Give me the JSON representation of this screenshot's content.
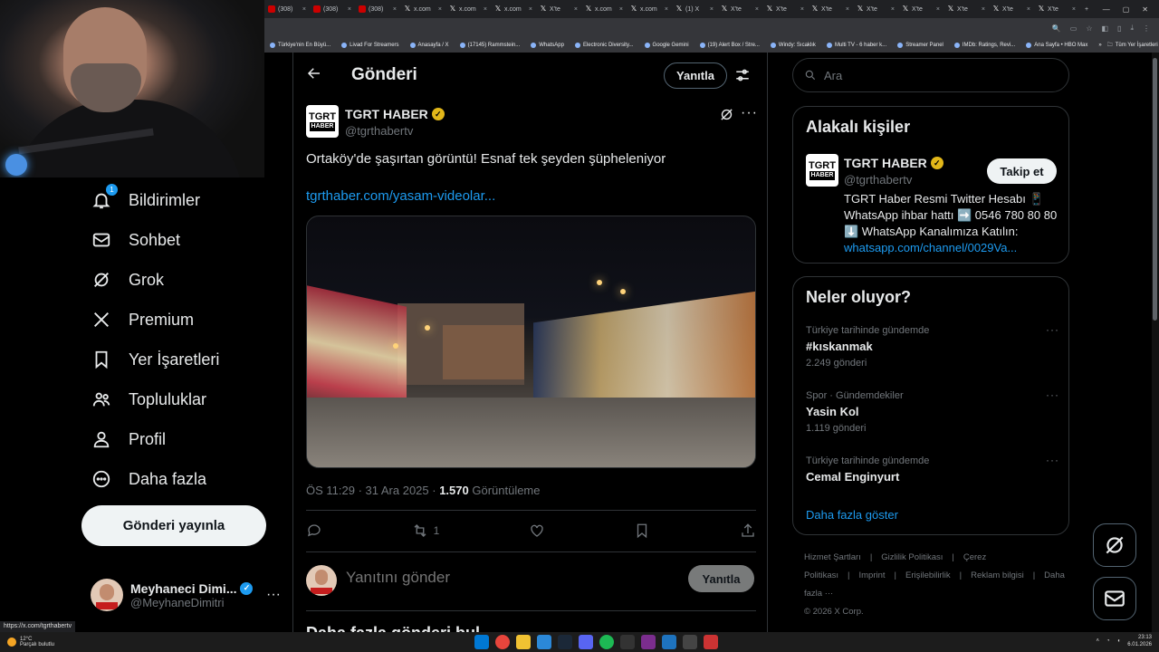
{
  "browser": {
    "tabs": [
      {
        "label": "(308)",
        "icon": "youtube-icon"
      },
      {
        "label": "(308)",
        "icon": "youtube-icon"
      },
      {
        "label": "(308)",
        "icon": "youtube-icon"
      },
      {
        "label": "x.com",
        "icon": "x-icon"
      },
      {
        "label": "x.com",
        "icon": "x-icon"
      },
      {
        "label": "x.com",
        "icon": "x-icon"
      },
      {
        "label": "X'te",
        "icon": "x-icon"
      },
      {
        "label": "x.com",
        "icon": "x-icon"
      },
      {
        "label": "x.com",
        "icon": "x-icon"
      },
      {
        "label": "(1) X",
        "icon": "x-icon"
      },
      {
        "label": "X'te",
        "icon": "x-icon"
      },
      {
        "label": "X'te",
        "icon": "x-icon"
      },
      {
        "label": "X'te",
        "icon": "x-icon"
      },
      {
        "label": "X'te",
        "icon": "x-icon"
      },
      {
        "label": "X'te",
        "icon": "x-icon"
      },
      {
        "label": "X'te",
        "icon": "x-icon"
      },
      {
        "label": "X'te",
        "icon": "x-icon"
      },
      {
        "label": "X'te",
        "icon": "x-icon"
      }
    ],
    "bookmarks": [
      "Türkiye'nin En Büyü...",
      "Livad For Streamers",
      "Anasayfa / X",
      "(17145) Rammstein...",
      "WhatsApp",
      "Electronic Diversity...",
      "Google Gemini",
      "(19) Alert Box / Stre...",
      "Windy: Sıcaklık",
      "Multi TV - 6 haber k...",
      "Streamer Panel",
      "IMDb: Ratings, Revi...",
      "Ana Sayfa • HBO Max"
    ],
    "bookmarks_more": "»",
    "all_bookmarks": "Tüm Yer İşaretleri",
    "status_url": "https://x.com/tgrthabertv"
  },
  "nav": {
    "items": [
      {
        "label": "Bildirimler",
        "icon": "bell-icon",
        "badge": "1"
      },
      {
        "label": "Sohbet",
        "icon": "mail-icon"
      },
      {
        "label": "Grok",
        "icon": "grok-icon"
      },
      {
        "label": "Premium",
        "icon": "x-logo-icon"
      },
      {
        "label": "Yer İşaretleri",
        "icon": "bookmark-icon"
      },
      {
        "label": "Topluluklar",
        "icon": "people-icon"
      },
      {
        "label": "Profil",
        "icon": "person-icon"
      },
      {
        "label": "Daha fazla",
        "icon": "more-circle-icon"
      }
    ],
    "post_button": "Gönderi yayınla",
    "profile": {
      "name": "Meyhaneci Dimi...",
      "handle": "@MeyhaneDimitri",
      "more": "···"
    }
  },
  "header": {
    "title": "Gönderi",
    "reply_button": "Yanıtla"
  },
  "tweet": {
    "author_name": "TGRT HABER",
    "author_handle": "@tgrthabertv",
    "avatar_text_1": "TGRT",
    "avatar_text_2": "HABER",
    "text": "Ortaköy'de şaşırtan görüntü! Esnaf tek şeyden şüpheleniyor",
    "link": "tgrthaber.com/yasam-videolar...",
    "time": "ÖS 11:29 · 31 Ara 2025 · ",
    "views_count": "1.570",
    "views_label": " Görüntüleme",
    "retweets": "1",
    "more": "···"
  },
  "reply": {
    "placeholder": "Yanıtını gönder",
    "button": "Yanıtla"
  },
  "next_heading": "Daha fazla gönderi bul",
  "search": {
    "placeholder": "Ara"
  },
  "related": {
    "title": "Alakalı kişiler",
    "name": "TGRT HABER",
    "handle": "@tgrthabertv",
    "follow_button": "Takip et",
    "bio": "TGRT Haber Resmi Twitter Hesabı 📱 WhatsApp ihbar hattı ➡️ 0546 780 80 80 ⬇️ WhatsApp Kanalımıza Katılın:",
    "bio_link": "whatsapp.com/channel/0029Va..."
  },
  "trends": {
    "title": "Neler oluyor?",
    "items": [
      {
        "category": "Türkiye tarihinde gündemde",
        "topic": "#kıskanmak",
        "count": "2.249 gönderi"
      },
      {
        "category": "Spor · Gündemdekiler",
        "topic": "Yasin Kol",
        "count": "1.119 gönderi"
      },
      {
        "category": "Türkiye tarihinde gündemde",
        "topic": "Cemal Enginyurt",
        "count": ""
      }
    ],
    "show_more": "Daha fazla göster"
  },
  "footer": {
    "links": [
      "Hizmet Şartları",
      "|",
      "Gizlilik Politikası",
      "|",
      "Çerez Politikası",
      "|",
      "Imprint",
      "|",
      "Erişilebilirlik",
      "|",
      "Reklam bilgisi",
      "|",
      "Daha fazla ···"
    ],
    "copyright": "© 2026 X Corp."
  },
  "taskbar": {
    "temperature": "12°C",
    "weather": "Parçalı bulutlu",
    "time": "23:13",
    "date": "6.01.2026"
  },
  "colors": {
    "accent": "#1d9bf0",
    "gold_check": "#e2b719",
    "background": "#000000",
    "muted": "#71767b"
  }
}
